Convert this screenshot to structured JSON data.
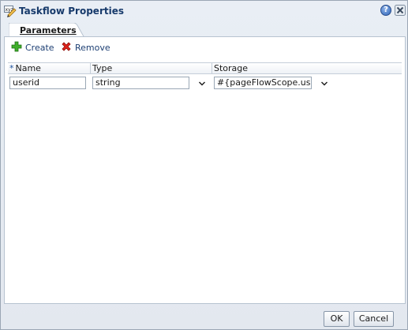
{
  "dialog": {
    "title": "Taskflow Properties",
    "title_icon": "xyz-pencil-icon",
    "help_icon": "help-icon",
    "close_icon": "close-icon"
  },
  "tabs": [
    {
      "label": "Parameters",
      "selected": true
    }
  ],
  "toolbar": {
    "create_label": "Create",
    "create_icon": "plus-icon",
    "remove_label": "Remove",
    "remove_icon": "red-x-icon"
  },
  "table": {
    "columns": [
      {
        "label": "Name",
        "required": true,
        "required_marker": "*"
      },
      {
        "label": "Type",
        "required": false
      },
      {
        "label": "Storage",
        "required": false
      }
    ],
    "rows": [
      {
        "name": "userid",
        "type": "string",
        "storage": "#{pageFlowScope.userid}"
      }
    ]
  },
  "footer": {
    "ok_label": "OK",
    "cancel_label": "Cancel"
  },
  "colors": {
    "title": "#173a6b",
    "link": "#1d3f73",
    "panel_bg": "#ffffff",
    "dialog_bg": "#e9edf3"
  }
}
